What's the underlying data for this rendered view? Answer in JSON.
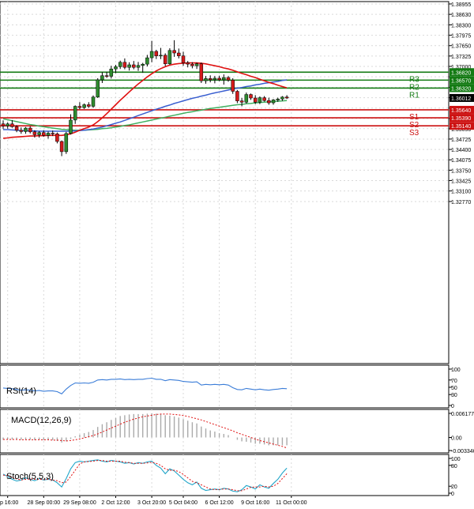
{
  "chart_data": {
    "type": "candlestick",
    "instrument_ticker_hidden": true,
    "colors": {
      "bull": "#2e8b2e",
      "bear": "#d41a1a",
      "ma_fast": "#e01010",
      "ma_mid": "#3a5fd0",
      "ma_slow": "#40b060",
      "support": "#cc1111",
      "resistance": "#137a13",
      "grid": "#d9d9d9",
      "axis": "#000000",
      "label_price_bg": "#000000"
    },
    "y_axis": {
      "min": 1.2777,
      "max": 1.38955,
      "ticks": [
        "1.38955",
        "1.38630",
        "1.38300",
        "1.37975",
        "1.37650",
        "1.37325",
        "1.37000",
        "1.36675",
        "1.36345",
        "1.36020",
        "1.35695",
        "1.35370",
        "1.35050",
        "1.34725",
        "1.34400",
        "1.34075",
        "1.33750",
        "1.33425",
        "1.33100",
        "1.32770"
      ]
    },
    "x_axis": {
      "labels": [
        "ep 16:00",
        "28 Sep 00:00",
        "29 Sep 08:00",
        "2 Oct 12:00",
        "3 Oct 20:00",
        "5 Oct 04:00",
        "6 Oct 12:00",
        "9 Oct 16:00",
        "11 Oct 00:00"
      ],
      "label_positions_candle_index": [
        1,
        9,
        17,
        25,
        33,
        40,
        48,
        56,
        64
      ]
    },
    "candles": [
      {
        "o": 1.352,
        "h": 1.3531,
        "l": 1.3504,
        "c": 1.3514
      },
      {
        "o": 1.3514,
        "h": 1.3525,
        "l": 1.3505,
        "c": 1.352
      },
      {
        "o": 1.352,
        "h": 1.3532,
        "l": 1.3508,
        "c": 1.3511
      },
      {
        "o": 1.3511,
        "h": 1.3516,
        "l": 1.3494,
        "c": 1.35
      },
      {
        "o": 1.35,
        "h": 1.3509,
        "l": 1.3489,
        "c": 1.3496
      },
      {
        "o": 1.3496,
        "h": 1.351,
        "l": 1.3489,
        "c": 1.3507
      },
      {
        "o": 1.3507,
        "h": 1.3512,
        "l": 1.349,
        "c": 1.3495
      },
      {
        "o": 1.3495,
        "h": 1.35,
        "l": 1.3477,
        "c": 1.3486
      },
      {
        "o": 1.3486,
        "h": 1.3497,
        "l": 1.3477,
        "c": 1.3493
      },
      {
        "o": 1.3493,
        "h": 1.35,
        "l": 1.348,
        "c": 1.3484
      },
      {
        "o": 1.3484,
        "h": 1.3496,
        "l": 1.3474,
        "c": 1.3491
      },
      {
        "o": 1.3491,
        "h": 1.3499,
        "l": 1.3482,
        "c": 1.3489
      },
      {
        "o": 1.3489,
        "h": 1.3493,
        "l": 1.3459,
        "c": 1.3465
      },
      {
        "o": 1.3465,
        "h": 1.3468,
        "l": 1.3419,
        "c": 1.3433
      },
      {
        "o": 1.3433,
        "h": 1.3495,
        "l": 1.3426,
        "c": 1.349
      },
      {
        "o": 1.349,
        "h": 1.355,
        "l": 1.3487,
        "c": 1.3532
      },
      {
        "o": 1.3532,
        "h": 1.3578,
        "l": 1.352,
        "c": 1.3575
      },
      {
        "o": 1.3575,
        "h": 1.3588,
        "l": 1.3566,
        "c": 1.3571
      },
      {
        "o": 1.3571,
        "h": 1.3584,
        "l": 1.3567,
        "c": 1.358
      },
      {
        "o": 1.358,
        "h": 1.3588,
        "l": 1.357,
        "c": 1.3575
      },
      {
        "o": 1.3575,
        "h": 1.3609,
        "l": 1.357,
        "c": 1.3604
      },
      {
        "o": 1.3604,
        "h": 1.3663,
        "l": 1.3601,
        "c": 1.3658
      },
      {
        "o": 1.3658,
        "h": 1.3682,
        "l": 1.3648,
        "c": 1.3671
      },
      {
        "o": 1.3671,
        "h": 1.3683,
        "l": 1.3664,
        "c": 1.3669
      },
      {
        "o": 1.3669,
        "h": 1.3702,
        "l": 1.3662,
        "c": 1.3692
      },
      {
        "o": 1.3692,
        "h": 1.3705,
        "l": 1.3679,
        "c": 1.3699
      },
      {
        "o": 1.3699,
        "h": 1.3718,
        "l": 1.3692,
        "c": 1.3713
      },
      {
        "o": 1.3713,
        "h": 1.3725,
        "l": 1.3691,
        "c": 1.3697
      },
      {
        "o": 1.3697,
        "h": 1.3713,
        "l": 1.3687,
        "c": 1.3705
      },
      {
        "o": 1.3705,
        "h": 1.3717,
        "l": 1.3691,
        "c": 1.3697
      },
      {
        "o": 1.3697,
        "h": 1.3714,
        "l": 1.3686,
        "c": 1.3703
      },
      {
        "o": 1.3703,
        "h": 1.3711,
        "l": 1.368,
        "c": 1.3707
      },
      {
        "o": 1.3707,
        "h": 1.3736,
        "l": 1.37,
        "c": 1.3727
      },
      {
        "o": 1.3727,
        "h": 1.378,
        "l": 1.3713,
        "c": 1.3747
      },
      {
        "o": 1.3747,
        "h": 1.3752,
        "l": 1.3723,
        "c": 1.3733
      },
      {
        "o": 1.3733,
        "h": 1.3758,
        "l": 1.3723,
        "c": 1.3735
      },
      {
        "o": 1.3735,
        "h": 1.3741,
        "l": 1.3701,
        "c": 1.3708
      },
      {
        "o": 1.3708,
        "h": 1.3757,
        "l": 1.3705,
        "c": 1.375
      },
      {
        "o": 1.375,
        "h": 1.3782,
        "l": 1.373,
        "c": 1.3742
      },
      {
        "o": 1.3742,
        "h": 1.3756,
        "l": 1.3725,
        "c": 1.3733
      },
      {
        "o": 1.3733,
        "h": 1.3746,
        "l": 1.3702,
        "c": 1.3711
      },
      {
        "o": 1.3711,
        "h": 1.3717,
        "l": 1.3697,
        "c": 1.3707
      },
      {
        "o": 1.3707,
        "h": 1.3713,
        "l": 1.3694,
        "c": 1.3702
      },
      {
        "o": 1.3702,
        "h": 1.3712,
        "l": 1.3692,
        "c": 1.3708
      },
      {
        "o": 1.3708,
        "h": 1.3712,
        "l": 1.3648,
        "c": 1.3655
      },
      {
        "o": 1.3655,
        "h": 1.367,
        "l": 1.3646,
        "c": 1.3662
      },
      {
        "o": 1.3662,
        "h": 1.3672,
        "l": 1.365,
        "c": 1.3658
      },
      {
        "o": 1.3658,
        "h": 1.367,
        "l": 1.3647,
        "c": 1.3663
      },
      {
        "o": 1.3663,
        "h": 1.3671,
        "l": 1.3654,
        "c": 1.3658
      },
      {
        "o": 1.3658,
        "h": 1.3675,
        "l": 1.3643,
        "c": 1.3665
      },
      {
        "o": 1.3665,
        "h": 1.367,
        "l": 1.3652,
        "c": 1.3657
      },
      {
        "o": 1.3657,
        "h": 1.3663,
        "l": 1.3614,
        "c": 1.3622
      },
      {
        "o": 1.3622,
        "h": 1.3626,
        "l": 1.3585,
        "c": 1.3592
      },
      {
        "o": 1.3592,
        "h": 1.3601,
        "l": 1.3575,
        "c": 1.3588
      },
      {
        "o": 1.3588,
        "h": 1.3618,
        "l": 1.3584,
        "c": 1.3612
      },
      {
        "o": 1.3612,
        "h": 1.3615,
        "l": 1.3595,
        "c": 1.3601
      },
      {
        "o": 1.3601,
        "h": 1.361,
        "l": 1.3582,
        "c": 1.3588
      },
      {
        "o": 1.3588,
        "h": 1.3606,
        "l": 1.3582,
        "c": 1.3602
      },
      {
        "o": 1.3602,
        "h": 1.3607,
        "l": 1.359,
        "c": 1.3593
      },
      {
        "o": 1.3593,
        "h": 1.3602,
        "l": 1.358,
        "c": 1.3586
      },
      {
        "o": 1.3586,
        "h": 1.3598,
        "l": 1.358,
        "c": 1.3595
      },
      {
        "o": 1.3595,
        "h": 1.3602,
        "l": 1.3589,
        "c": 1.3598
      },
      {
        "o": 1.3598,
        "h": 1.3607,
        "l": 1.3592,
        "c": 1.3604
      },
      {
        "o": 1.3604,
        "h": 1.361,
        "l": 1.3598,
        "c": 1.3601
      }
    ],
    "moving_averages": {
      "fast": [
        1.3475,
        1.3476,
        1.3478,
        1.3479,
        1.348,
        1.3481,
        1.3482,
        1.3482,
        1.3483,
        1.3483,
        1.3484,
        1.3484,
        1.3484,
        1.3484,
        1.3486,
        1.3489,
        1.3494,
        1.35,
        1.3505,
        1.351,
        1.3517,
        1.3527,
        1.3539,
        1.3552,
        1.3566,
        1.358,
        1.3594,
        1.3607,
        1.362,
        1.3633,
        1.3645,
        1.3656,
        1.3667,
        1.3677,
        1.3686,
        1.3693,
        1.3699,
        1.3704,
        1.3707,
        1.3709,
        1.371,
        1.3711,
        1.3711,
        1.3711,
        1.371,
        1.3708,
        1.3705,
        1.3702,
        1.3699,
        1.3695,
        1.3692,
        1.3688,
        1.3683,
        1.3678,
        1.3674,
        1.3669,
        1.3665,
        1.366,
        1.3655,
        1.365,
        1.3646,
        1.3641,
        1.3637,
        1.3633
      ],
      "mid": [
        1.3502,
        1.3502,
        1.3501,
        1.35,
        1.3499,
        1.3499,
        1.3498,
        1.3498,
        1.3497,
        1.3497,
        1.3497,
        1.3497,
        1.3497,
        1.3497,
        1.3497,
        1.3497,
        1.3498,
        1.3499,
        1.35,
        1.3502,
        1.3504,
        1.3507,
        1.351,
        1.3514,
        1.3518,
        1.3522,
        1.3526,
        1.3531,
        1.3536,
        1.3541,
        1.3546,
        1.3551,
        1.3556,
        1.3561,
        1.3566,
        1.357,
        1.3575,
        1.3579,
        1.3584,
        1.3588,
        1.3592,
        1.3596,
        1.36,
        1.3603,
        1.3607,
        1.361,
        1.3614,
        1.3617,
        1.362,
        1.3623,
        1.3626,
        1.3629,
        1.3632,
        1.3634,
        1.3637,
        1.3639,
        1.3642,
        1.3644,
        1.3647,
        1.3649,
        1.3651,
        1.3653,
        1.3656,
        1.3658
      ],
      "slow": [
        1.3536,
        1.3533,
        1.353,
        1.3527,
        1.3524,
        1.3521,
        1.3518,
        1.3516,
        1.3513,
        1.3511,
        1.3509,
        1.3507,
        1.3505,
        1.3503,
        1.3502,
        1.3501,
        1.35,
        1.35,
        1.35,
        1.3501,
        1.3502,
        1.3503,
        1.3505,
        1.3506,
        1.3508,
        1.351,
        1.3512,
        1.3515,
        1.3517,
        1.352,
        1.3523,
        1.3526,
        1.3529,
        1.3532,
        1.3535,
        1.3538,
        1.3541,
        1.3544,
        1.3547,
        1.355,
        1.3553,
        1.3556,
        1.3558,
        1.3561,
        1.3563,
        1.3566,
        1.3568,
        1.357,
        1.3572,
        1.3574,
        1.3576,
        1.3578,
        1.358,
        1.3581,
        1.3583,
        1.3584,
        1.3586,
        1.3587,
        1.3588,
        1.3589,
        1.359,
        1.3591,
        1.3592,
        1.3593
      ]
    },
    "levels": [
      {
        "name": "R3",
        "value": 1.3682,
        "type": "resistance",
        "label": "1.36820"
      },
      {
        "name": "R2",
        "value": 1.3657,
        "type": "resistance",
        "label": "1.36570"
      },
      {
        "name": "R1",
        "value": 1.3632,
        "type": "resistance",
        "label": "1.36320"
      },
      {
        "name": "S1",
        "value": 1.3564,
        "type": "support",
        "label": "1.35640"
      },
      {
        "name": "S2",
        "value": 1.3539,
        "type": "support",
        "label": "1.35390"
      },
      {
        "name": "S3",
        "value": 1.3514,
        "type": "support",
        "label": "1.35140"
      }
    ],
    "current_price": {
      "value": 1.36012,
      "label": "1.36012"
    },
    "indicators": {
      "rsi": {
        "label": "RSI(14)",
        "ticks": [
          "100",
          "70",
          "50",
          "30",
          "0"
        ],
        "tick_values": [
          100,
          70,
          50,
          30,
          0
        ],
        "values": [
          48,
          47,
          46,
          44,
          42,
          43,
          42,
          40,
          41,
          39,
          40,
          40,
          38,
          32,
          45,
          55,
          62,
          61,
          62,
          61,
          64,
          70,
          71,
          70,
          72,
          72,
          73,
          71,
          72,
          71,
          72,
          72,
          74,
          75,
          72,
          72,
          68,
          71,
          70,
          69,
          66,
          65,
          64,
          65,
          56,
          58,
          57,
          58,
          57,
          58,
          56,
          49,
          44,
          43,
          47,
          45,
          43,
          45,
          43,
          42,
          44,
          45,
          47,
          46
        ],
        "color": "#3b7dd8"
      },
      "macd": {
        "label": "MACD(12,26,9)",
        "ticks": [
          "0.006177",
          "0.00",
          "-0.003346"
        ],
        "tick_values": [
          0.006177,
          0,
          -0.003346
        ],
        "histogram": [
          -0.0006,
          -0.0005,
          -0.0005,
          -0.0006,
          -0.0006,
          -0.0005,
          -0.0006,
          -0.0007,
          -0.0006,
          -0.0007,
          -0.0007,
          -0.0007,
          -0.0009,
          -0.0013,
          -0.001,
          -0.0004,
          0.0003,
          0.0007,
          0.0011,
          0.0014,
          0.0019,
          0.0027,
          0.0034,
          0.0039,
          0.0045,
          0.005,
          0.0055,
          0.0057,
          0.0059,
          0.006,
          0.006,
          0.006,
          0.0061,
          0.0062,
          0.0061,
          0.006,
          0.0057,
          0.0056,
          0.0054,
          0.0051,
          0.0047,
          0.0043,
          0.0039,
          0.0036,
          0.0028,
          0.0023,
          0.0018,
          0.0015,
          0.0011,
          0.0009,
          0.0006,
          0.0,
          -0.0006,
          -0.001,
          -0.0011,
          -0.0013,
          -0.0016,
          -0.0016,
          -0.0018,
          -0.002,
          -0.002,
          -0.002,
          -0.002,
          -0.002
        ],
        "signal": [
          -0.0005,
          -0.0005,
          -0.0005,
          -0.0005,
          -0.0006,
          -0.0006,
          -0.0006,
          -0.0006,
          -0.0006,
          -0.0006,
          -0.0006,
          -0.0007,
          -0.0007,
          -0.0008,
          -0.0009,
          -0.0008,
          -0.0006,
          -0.0004,
          -0.0001,
          0.0002,
          0.0005,
          0.0009,
          0.0014,
          0.0019,
          0.0024,
          0.0029,
          0.0034,
          0.0039,
          0.0043,
          0.0047,
          0.005,
          0.0053,
          0.0055,
          0.0057,
          0.0059,
          0.006,
          0.006,
          0.006,
          0.0059,
          0.0058,
          0.0056,
          0.0054,
          0.0051,
          0.0048,
          0.0045,
          0.0041,
          0.0037,
          0.0033,
          0.0029,
          0.0025,
          0.0021,
          0.0017,
          0.0012,
          0.0008,
          0.0004,
          0.0,
          -0.0004,
          -0.0008,
          -0.0011,
          -0.0014,
          -0.0017,
          -0.002,
          -0.0023,
          -0.0027
        ],
        "hist_color": "#aaaaaa",
        "signal_color": "#e01010"
      },
      "stoch": {
        "label": "Stoch(5,5,3)",
        "ticks": [
          "100",
          "80",
          "20",
          "0"
        ],
        "tick_values": [
          100,
          80,
          20,
          0
        ],
        "k": [
          55,
          48,
          40,
          35,
          38,
          44,
          40,
          36,
          42,
          38,
          40,
          38,
          30,
          18,
          42,
          70,
          88,
          92,
          90,
          92,
          94,
          96,
          92,
          90,
          94,
          92,
          90,
          86,
          88,
          84,
          88,
          86,
          90,
          92,
          80,
          72,
          56,
          70,
          64,
          52,
          40,
          30,
          24,
          32,
          14,
          8,
          10,
          12,
          10,
          14,
          12,
          6,
          4,
          10,
          22,
          18,
          12,
          24,
          18,
          14,
          28,
          40,
          58,
          72
        ],
        "d": [
          52,
          50,
          46,
          41,
          38,
          40,
          41,
          40,
          40,
          39,
          40,
          38,
          36,
          30,
          32,
          48,
          66,
          84,
          90,
          91,
          92,
          94,
          94,
          92,
          92,
          92,
          92,
          89,
          88,
          86,
          86,
          86,
          87,
          89,
          86,
          80,
          70,
          66,
          66,
          62,
          54,
          44,
          34,
          30,
          24,
          18,
          12,
          10,
          11,
          12,
          12,
          10,
          7,
          7,
          12,
          17,
          18,
          18,
          20,
          18,
          20,
          28,
          42,
          56
        ],
        "k_color": "#22a6c9",
        "d_color": "#e01010"
      }
    }
  }
}
